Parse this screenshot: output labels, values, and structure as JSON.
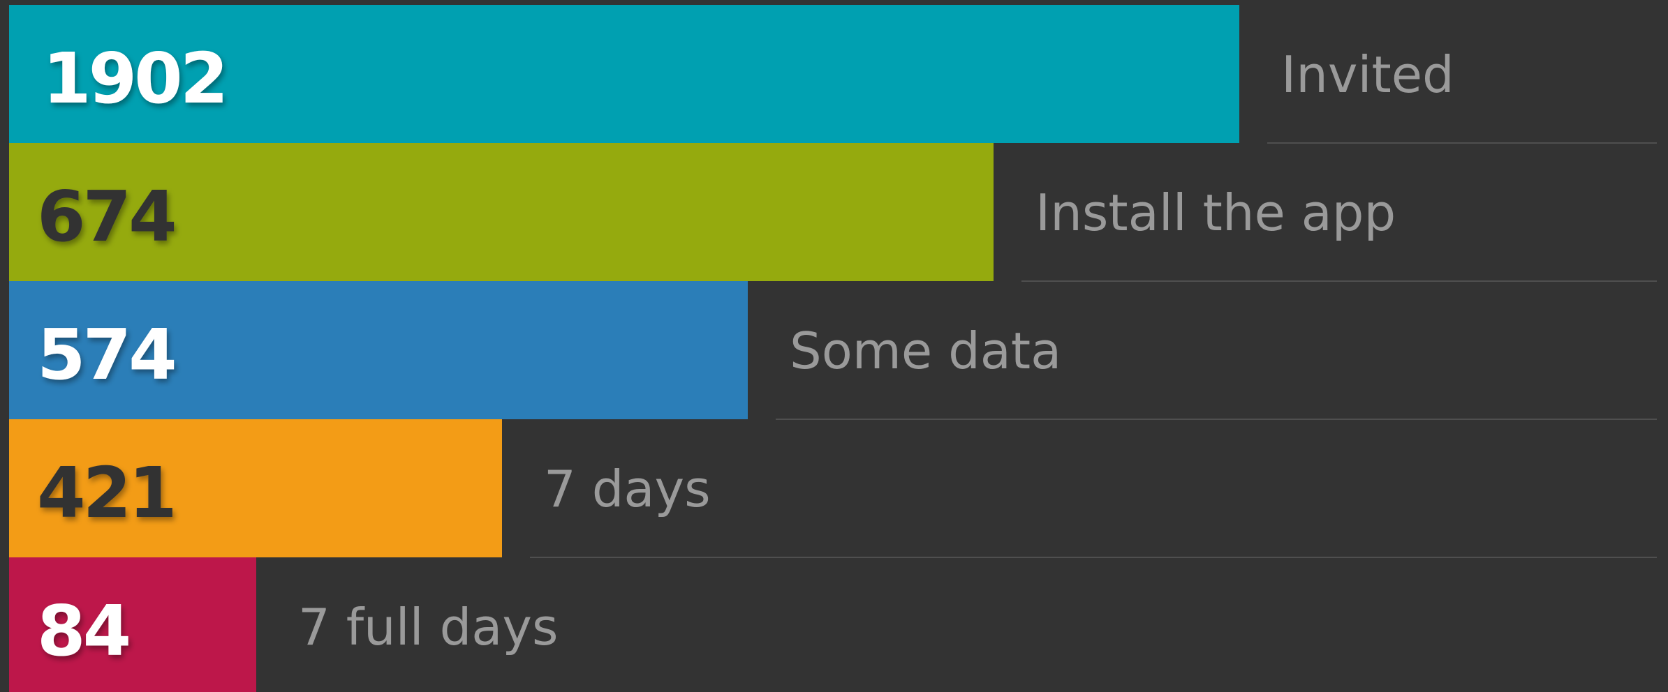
{
  "chart_data": {
    "type": "bar",
    "orientation": "horizontal",
    "categories": [
      "Invited",
      "Install the app",
      "Some data",
      "7 days",
      "7 full days"
    ],
    "values": [
      1902,
      674,
      574,
      421,
      84
    ],
    "colors": [
      "#00a0b1",
      "#95aa0e",
      "#2b7eb8",
      "#f39c16",
      "#bd174a"
    ],
    "value_label_colors": [
      "#ffffff",
      "#333333",
      "#ffffff",
      "#333333",
      "#ffffff"
    ],
    "background": "#333333",
    "grid": false,
    "legend": "none"
  }
}
